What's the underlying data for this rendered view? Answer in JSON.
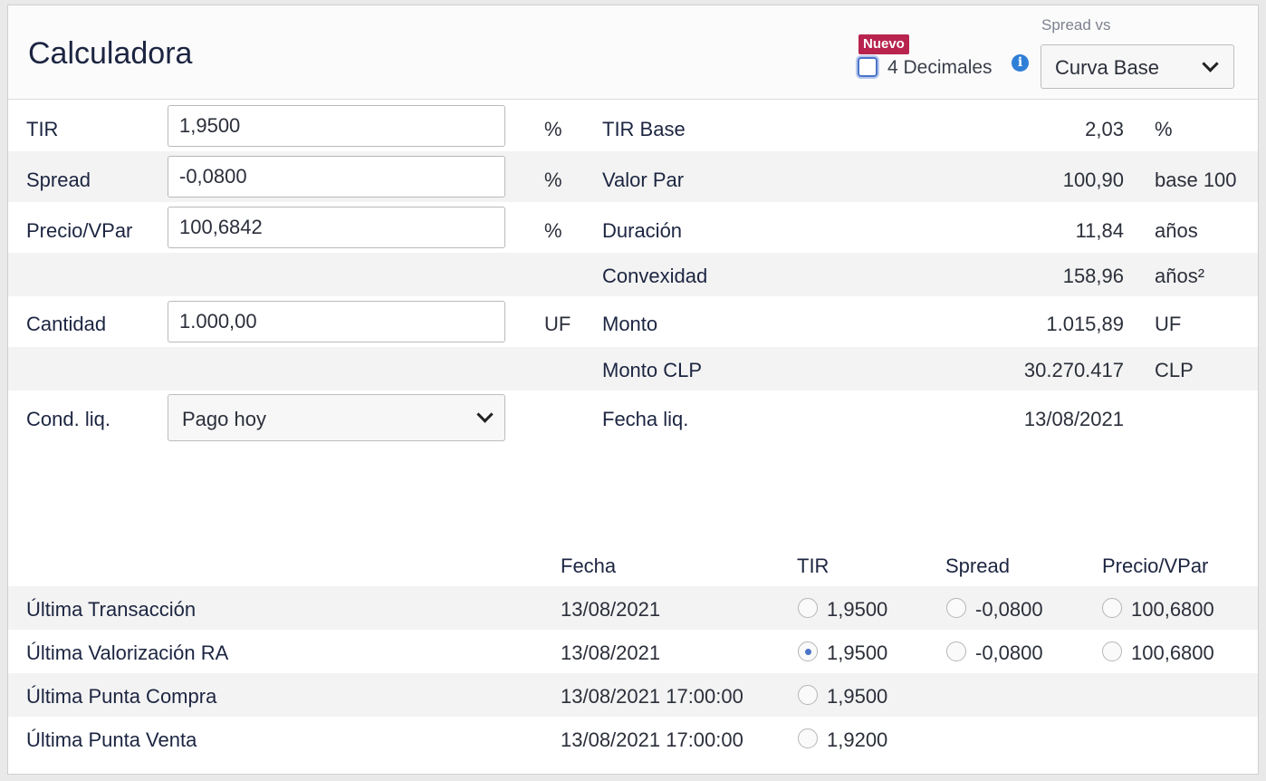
{
  "header": {
    "title": "Calculadora",
    "badge": "Nuevo",
    "decimals_label": "4 Decimales",
    "decimals_checked": false,
    "spread_vs_label": "Spread vs",
    "spread_vs_value": "Curva Base",
    "info_icon": "info-icon"
  },
  "inputs": {
    "tir": {
      "label": "TIR",
      "value": "1,9500",
      "unit": "%"
    },
    "spread": {
      "label": "Spread",
      "value": "-0,0800",
      "unit": "%"
    },
    "precio": {
      "label": "Precio/VPar",
      "value": "100,6842",
      "unit": "%"
    },
    "cantidad": {
      "label": "Cantidad",
      "value": "1.000,00",
      "unit": "UF"
    },
    "cond": {
      "label": "Cond. liq.",
      "value": "Pago hoy"
    }
  },
  "results": {
    "tir_base": {
      "label": "TIR Base",
      "value": "2,03",
      "unit": "%"
    },
    "valor_par": {
      "label": "Valor Par",
      "value": "100,90",
      "unit": "base 100"
    },
    "duracion": {
      "label": "Duración",
      "value": "11,84",
      "unit": "años"
    },
    "convexidad": {
      "label": "Convexidad",
      "value": "158,96",
      "unit": "años²"
    },
    "monto": {
      "label": "Monto",
      "value": "1.015,89",
      "unit": "UF"
    },
    "monto_clp": {
      "label": "Monto CLP",
      "value": "30.270.417",
      "unit": "CLP"
    },
    "fecha_liq": {
      "label": "Fecha liq.",
      "value": "13/08/2021"
    }
  },
  "table": {
    "headers": {
      "fecha": "Fecha",
      "tir": "TIR",
      "spread": "Spread",
      "precio": "Precio/VPar"
    },
    "rows": [
      {
        "name": "Última Transacción",
        "fecha": "13/08/2021",
        "tir": "1,9500",
        "spread": "-0,0800",
        "precio": "100,6800",
        "tir_selected": false
      },
      {
        "name": "Última Valorización RA",
        "fecha": "13/08/2021",
        "tir": "1,9500",
        "spread": "-0,0800",
        "precio": "100,6800",
        "tir_selected": true
      },
      {
        "name": "Última Punta Compra",
        "fecha": "13/08/2021 17:00:00",
        "tir": "1,9500",
        "tir_selected": false
      },
      {
        "name": "Última Punta Venta",
        "fecha": "13/08/2021 17:00:00",
        "tir": "1,9200",
        "tir_selected": false
      }
    ]
  }
}
